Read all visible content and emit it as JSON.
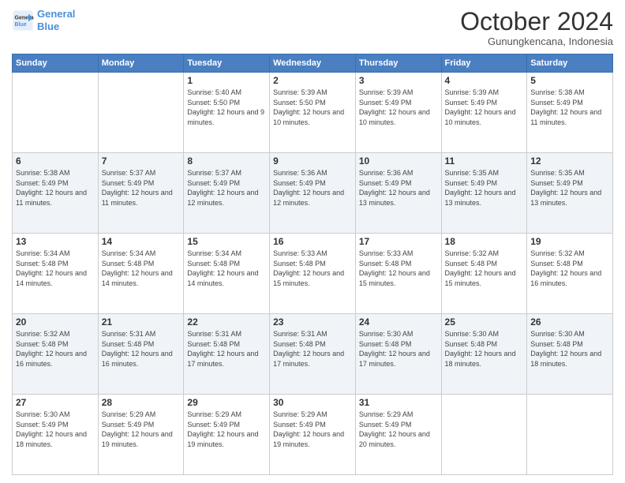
{
  "logo": {
    "line1": "General",
    "line2": "Blue"
  },
  "header": {
    "month": "October 2024",
    "location": "Gunungkencana, Indonesia"
  },
  "weekdays": [
    "Sunday",
    "Monday",
    "Tuesday",
    "Wednesday",
    "Thursday",
    "Friday",
    "Saturday"
  ],
  "weeks": [
    [
      {
        "day": "",
        "sunrise": "",
        "sunset": "",
        "daylight": ""
      },
      {
        "day": "",
        "sunrise": "",
        "sunset": "",
        "daylight": ""
      },
      {
        "day": "1",
        "sunrise": "Sunrise: 5:40 AM",
        "sunset": "Sunset: 5:50 PM",
        "daylight": "Daylight: 12 hours and 9 minutes."
      },
      {
        "day": "2",
        "sunrise": "Sunrise: 5:39 AM",
        "sunset": "Sunset: 5:50 PM",
        "daylight": "Daylight: 12 hours and 10 minutes."
      },
      {
        "day": "3",
        "sunrise": "Sunrise: 5:39 AM",
        "sunset": "Sunset: 5:49 PM",
        "daylight": "Daylight: 12 hours and 10 minutes."
      },
      {
        "day": "4",
        "sunrise": "Sunrise: 5:39 AM",
        "sunset": "Sunset: 5:49 PM",
        "daylight": "Daylight: 12 hours and 10 minutes."
      },
      {
        "day": "5",
        "sunrise": "Sunrise: 5:38 AM",
        "sunset": "Sunset: 5:49 PM",
        "daylight": "Daylight: 12 hours and 11 minutes."
      }
    ],
    [
      {
        "day": "6",
        "sunrise": "Sunrise: 5:38 AM",
        "sunset": "Sunset: 5:49 PM",
        "daylight": "Daylight: 12 hours and 11 minutes."
      },
      {
        "day": "7",
        "sunrise": "Sunrise: 5:37 AM",
        "sunset": "Sunset: 5:49 PM",
        "daylight": "Daylight: 12 hours and 11 minutes."
      },
      {
        "day": "8",
        "sunrise": "Sunrise: 5:37 AM",
        "sunset": "Sunset: 5:49 PM",
        "daylight": "Daylight: 12 hours and 12 minutes."
      },
      {
        "day": "9",
        "sunrise": "Sunrise: 5:36 AM",
        "sunset": "Sunset: 5:49 PM",
        "daylight": "Daylight: 12 hours and 12 minutes."
      },
      {
        "day": "10",
        "sunrise": "Sunrise: 5:36 AM",
        "sunset": "Sunset: 5:49 PM",
        "daylight": "Daylight: 12 hours and 13 minutes."
      },
      {
        "day": "11",
        "sunrise": "Sunrise: 5:35 AM",
        "sunset": "Sunset: 5:49 PM",
        "daylight": "Daylight: 12 hours and 13 minutes."
      },
      {
        "day": "12",
        "sunrise": "Sunrise: 5:35 AM",
        "sunset": "Sunset: 5:49 PM",
        "daylight": "Daylight: 12 hours and 13 minutes."
      }
    ],
    [
      {
        "day": "13",
        "sunrise": "Sunrise: 5:34 AM",
        "sunset": "Sunset: 5:48 PM",
        "daylight": "Daylight: 12 hours and 14 minutes."
      },
      {
        "day": "14",
        "sunrise": "Sunrise: 5:34 AM",
        "sunset": "Sunset: 5:48 PM",
        "daylight": "Daylight: 12 hours and 14 minutes."
      },
      {
        "day": "15",
        "sunrise": "Sunrise: 5:34 AM",
        "sunset": "Sunset: 5:48 PM",
        "daylight": "Daylight: 12 hours and 14 minutes."
      },
      {
        "day": "16",
        "sunrise": "Sunrise: 5:33 AM",
        "sunset": "Sunset: 5:48 PM",
        "daylight": "Daylight: 12 hours and 15 minutes."
      },
      {
        "day": "17",
        "sunrise": "Sunrise: 5:33 AM",
        "sunset": "Sunset: 5:48 PM",
        "daylight": "Daylight: 12 hours and 15 minutes."
      },
      {
        "day": "18",
        "sunrise": "Sunrise: 5:32 AM",
        "sunset": "Sunset: 5:48 PM",
        "daylight": "Daylight: 12 hours and 15 minutes."
      },
      {
        "day": "19",
        "sunrise": "Sunrise: 5:32 AM",
        "sunset": "Sunset: 5:48 PM",
        "daylight": "Daylight: 12 hours and 16 minutes."
      }
    ],
    [
      {
        "day": "20",
        "sunrise": "Sunrise: 5:32 AM",
        "sunset": "Sunset: 5:48 PM",
        "daylight": "Daylight: 12 hours and 16 minutes."
      },
      {
        "day": "21",
        "sunrise": "Sunrise: 5:31 AM",
        "sunset": "Sunset: 5:48 PM",
        "daylight": "Daylight: 12 hours and 16 minutes."
      },
      {
        "day": "22",
        "sunrise": "Sunrise: 5:31 AM",
        "sunset": "Sunset: 5:48 PM",
        "daylight": "Daylight: 12 hours and 17 minutes."
      },
      {
        "day": "23",
        "sunrise": "Sunrise: 5:31 AM",
        "sunset": "Sunset: 5:48 PM",
        "daylight": "Daylight: 12 hours and 17 minutes."
      },
      {
        "day": "24",
        "sunrise": "Sunrise: 5:30 AM",
        "sunset": "Sunset: 5:48 PM",
        "daylight": "Daylight: 12 hours and 17 minutes."
      },
      {
        "day": "25",
        "sunrise": "Sunrise: 5:30 AM",
        "sunset": "Sunset: 5:48 PM",
        "daylight": "Daylight: 12 hours and 18 minutes."
      },
      {
        "day": "26",
        "sunrise": "Sunrise: 5:30 AM",
        "sunset": "Sunset: 5:48 PM",
        "daylight": "Daylight: 12 hours and 18 minutes."
      }
    ],
    [
      {
        "day": "27",
        "sunrise": "Sunrise: 5:30 AM",
        "sunset": "Sunset: 5:49 PM",
        "daylight": "Daylight: 12 hours and 18 minutes."
      },
      {
        "day": "28",
        "sunrise": "Sunrise: 5:29 AM",
        "sunset": "Sunset: 5:49 PM",
        "daylight": "Daylight: 12 hours and 19 minutes."
      },
      {
        "day": "29",
        "sunrise": "Sunrise: 5:29 AM",
        "sunset": "Sunset: 5:49 PM",
        "daylight": "Daylight: 12 hours and 19 minutes."
      },
      {
        "day": "30",
        "sunrise": "Sunrise: 5:29 AM",
        "sunset": "Sunset: 5:49 PM",
        "daylight": "Daylight: 12 hours and 19 minutes."
      },
      {
        "day": "31",
        "sunrise": "Sunrise: 5:29 AM",
        "sunset": "Sunset: 5:49 PM",
        "daylight": "Daylight: 12 hours and 20 minutes."
      },
      {
        "day": "",
        "sunrise": "",
        "sunset": "",
        "daylight": ""
      },
      {
        "day": "",
        "sunrise": "",
        "sunset": "",
        "daylight": ""
      }
    ]
  ]
}
